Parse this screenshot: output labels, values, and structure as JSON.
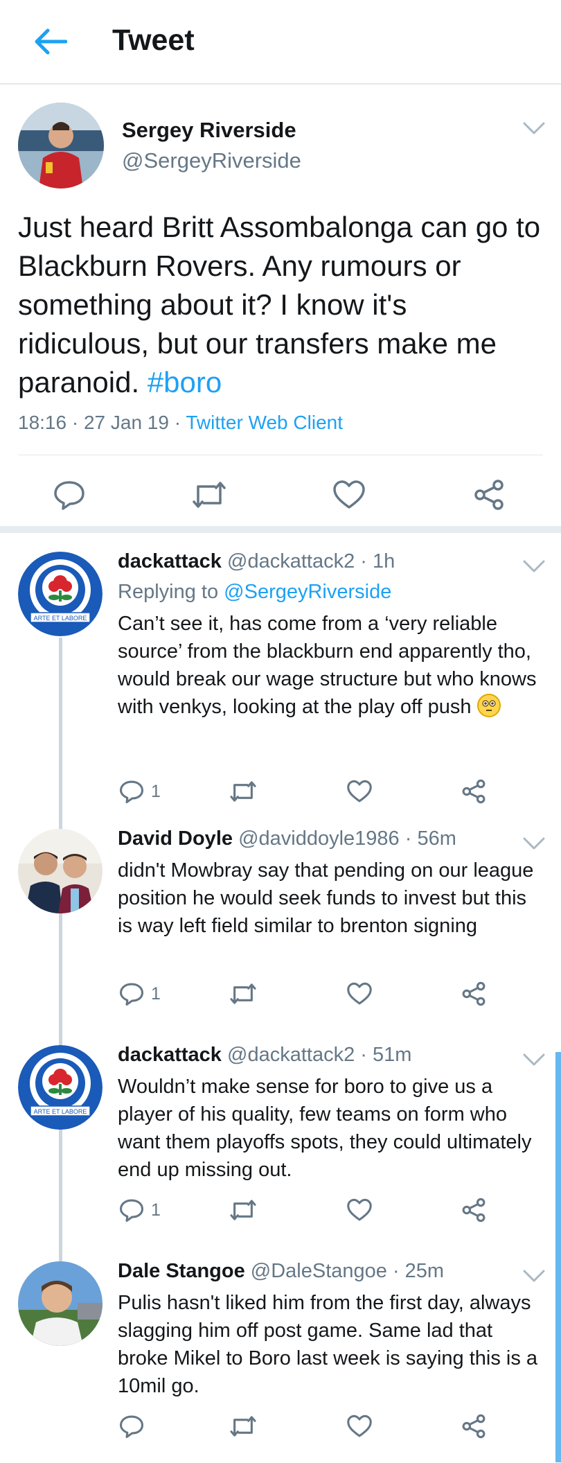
{
  "header": {
    "title": "Tweet"
  },
  "main_tweet": {
    "name": "Sergey Riverside",
    "handle": "@SergeyRiverside",
    "text": "Just heard Britt Assombalonga can go to Blackburn Rovers. Any rumours or something about it? I know it's ridiculous, but our transfers make me paranoid.",
    "hashtag": "#boro",
    "timestamp": "18:16 · 27 Jan 19 · ",
    "client": "Twitter Web Client"
  },
  "replies": [
    {
      "name": "dackattack",
      "handle": "@dackattack2 · 1h",
      "replying_prefix": "Replying to ",
      "replying_to": "@SergeyRiverside",
      "text": "Can’t see it, has come from a ‘very reliable source’ from the blackburn end apparently tho, would break our wage structure but who knows with venkys, looking at the play off push",
      "reply_count": "1"
    },
    {
      "name": "David Doyle",
      "handle": "@daviddoyle1986 · 56m",
      "text": "didn't Mowbray say that pending on our league position he would seek funds to invest but this is way left field similar to brenton signing",
      "reply_count": "1"
    },
    {
      "name": "dackattack",
      "handle": "@dackattack2 · 51m",
      "text": "Wouldn’t make sense for boro to give us a player of his quality, few teams on form who want them playoffs spots, they could ultimately end up missing out.",
      "reply_count": "1"
    },
    {
      "name": "Dale Stangoe",
      "handle": "@DaleStangoe · 25m",
      "text": "Pulis hasn't liked him from the first day, always slagging him off post game. Same lad that broke Mikel to Boro last week is saying this is a 10mil go.",
      "reply_count": ""
    }
  ],
  "badge_text": "ARTE ET LABORE",
  "colors": {
    "accent": "#1da1f2",
    "text": "#14171a",
    "muted": "#657786",
    "divider": "#e1e8ed"
  },
  "icons": [
    "back-arrow-icon",
    "chevron-down-icon",
    "reply-icon",
    "retweet-icon",
    "like-icon",
    "share-icon",
    "flushed-emoji-icon"
  ]
}
